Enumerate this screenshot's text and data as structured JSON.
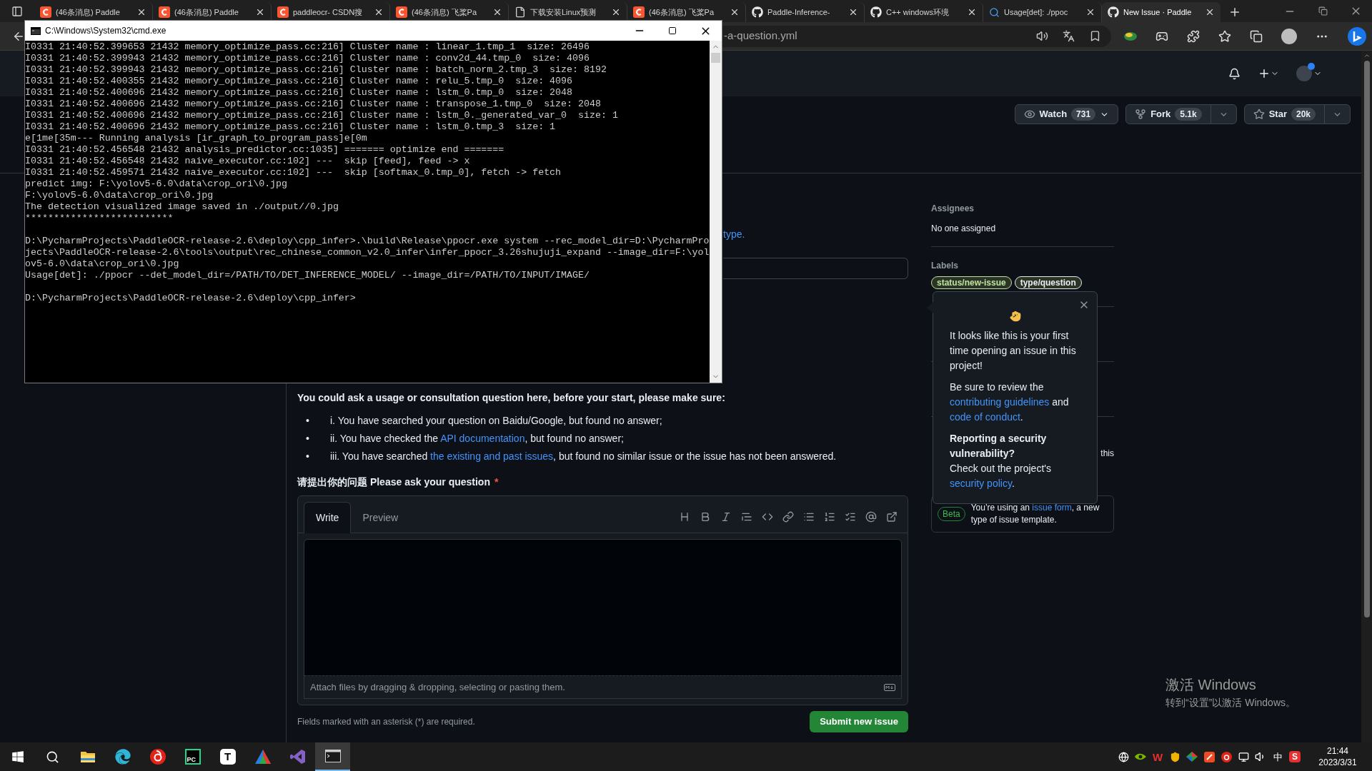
{
  "browser": {
    "tabs": [
      {
        "kind": "csdn",
        "title": "(46条消息) Paddle",
        "selected": false
      },
      {
        "kind": "csdn",
        "title": "(46条消息) Paddle",
        "selected": false
      },
      {
        "kind": "csdn",
        "title": "paddleocr- CSDN搜",
        "selected": false
      },
      {
        "kind": "csdn",
        "title": "(46条消息) 飞桨Pa",
        "selected": false
      },
      {
        "kind": "page",
        "title": "下载安装Linux预测",
        "selected": false
      },
      {
        "kind": "csdn",
        "title": "(46条消息) 飞桨Pa",
        "selected": false
      },
      {
        "kind": "github",
        "title": "Paddle-Inference-",
        "selected": false
      },
      {
        "kind": "github",
        "title": "C++ windows环境",
        "selected": false
      },
      {
        "kind": "search",
        "title": "Usage[det]: ./ppoc",
        "selected": false
      },
      {
        "kind": "github",
        "title": "New Issue · Paddle",
        "selected": true
      }
    ],
    "address": {
      "url": "-a-question.yml"
    }
  },
  "console": {
    "title": "C:\\Windows\\System32\\cmd.exe",
    "blocks": [
      [
        "I0331 21:40:52.399653 21432 memory_optimize_pass.cc:216] Cluster name : linear_1.tmp_1  size: 26496",
        "I0331 21:40:52.399943 21432 memory_optimize_pass.cc:216] Cluster name : conv2d_44.tmp_0  size: 4096",
        "I0331 21:40:52.399943 21432 memory_optimize_pass.cc:216] Cluster name : batch_norm_2.tmp_3  size: 8192",
        "I0331 21:40:52.400355 21432 memory_optimize_pass.cc:216] Cluster name : relu_5.tmp_0  size: 4096",
        "I0331 21:40:52.400696 21432 memory_optimize_pass.cc:216] Cluster name : lstm_0.tmp_0  size: 2048",
        "I0331 21:40:52.400696 21432 memory_optimize_pass.cc:216] Cluster name : transpose_1.tmp_0  size: 2048",
        "I0331 21:40:52.400696 21432 memory_optimize_pass.cc:216] Cluster name : lstm_0._generated_var_0  size: 1",
        "I0331 21:40:52.400696 21432 memory_optimize_pass.cc:216] Cluster name : lstm_0.tmp_3  size: 1",
        "e[1me[35m--- Running analysis [ir_graph_to_program_pass]e[0m",
        "I0331 21:40:52.456548 21432 analysis_predictor.cc:1035] ======= optimize end =======",
        "I0331 21:40:52.456548 21432 naive_executor.cc:102] ---  skip [feed], feed -> x",
        "I0331 21:40:52.459571 21432 naive_executor.cc:102] ---  skip [softmax_0.tmp_0], fetch -> fetch",
        "predict img: F:\\yolov5-6.0\\data\\crop_ori\\0.jpg",
        "F:\\yolov5-6.0\\data\\crop_ori\\0.jpg",
        "The detection visualized image saved in ./output//0.jpg",
        "**************************"
      ],
      [
        "D:\\PycharmProjects\\PaddleOCR-release-2.6\\deploy\\cpp_infer>.\\build\\Release\\ppocr.exe system --rec_model_dir=D:\\PycharmPro",
        "jects\\PaddleOCR-release-2.6\\tools\\output\\rec_chinese_common_v2.0_infer\\infer_ppocr_3.26shujuji_expand --image_dir=F:\\yol",
        "ov5-6.0\\data\\crop_ori\\0.jpg",
        "Usage[det]: ./ppocr --det_model_dir=/PATH/TO/DET_INFERENCE_MODEL/ --image_dir=/PATH/TO/INPUT/IMAGE/"
      ],
      [
        "D:\\PycharmProjects\\PaddleOCR-release-2.6\\deploy\\cpp_infer>"
      ]
    ]
  },
  "repo_actions": [
    {
      "kind": "watch",
      "label": "Watch",
      "count": "731"
    },
    {
      "kind": "fork",
      "label": "Fork",
      "count": "5.1k"
    },
    {
      "kind": "star",
      "label": "Star",
      "count": "20k"
    }
  ],
  "form": {
    "hint_tail": "type.",
    "intro": "You could ask a usage or consultation question here, before your start, please make sure:",
    "checklist": [
      {
        "marker": "•",
        "segments": [
          {
            "kind": "text",
            "text": "i. You have searched your question on Baidu/Google, but found no answer;"
          }
        ]
      },
      {
        "marker": "•",
        "segments": [
          {
            "kind": "text",
            "text": "ii. You have checked the "
          },
          {
            "kind": "link",
            "text": "API documentation"
          },
          {
            "kind": "text",
            "text": ", but found no answer;"
          }
        ]
      },
      {
        "marker": "•",
        "segments": [
          {
            "kind": "text",
            "text": "iii. You have searched "
          },
          {
            "kind": "link",
            "text": "the existing and past issues"
          },
          {
            "kind": "text",
            "text": ", but found no similar issue or the issue has not been answered."
          }
        ]
      }
    ],
    "question_label": "请提出你的问题 Please ask your question",
    "required_mark": "*",
    "editor": {
      "tabs": [
        {
          "label": "Write",
          "selected": true
        },
        {
          "label": "Preview",
          "selected": false
        }
      ],
      "attach_hint": "Attach files by dragging & dropping, selecting or pasting them."
    },
    "required_note": "Fields marked with an asterisk (*) are required.",
    "submit": "Submit new issue"
  },
  "sidebar": {
    "assignees_heading": "Assignees",
    "assignees_value": "No one assigned",
    "labels_heading": "Labels",
    "labels": [
      {
        "name": "status/new-issue",
        "color": "#bfe3a0"
      },
      {
        "name": "type/question",
        "color": "#e6edf3"
      }
    ],
    "hidden_tail": "this",
    "beta": {
      "badge": "Beta",
      "segments": [
        {
          "kind": "text",
          "text": "You’re using an "
        },
        {
          "kind": "link",
          "text": "issue form"
        },
        {
          "kind": "text",
          "text": ", a new type of issue template."
        }
      ]
    }
  },
  "popover": {
    "paragraphs": [
      {
        "segments": [
          {
            "kind": "text",
            "text": "It looks like this is your first time opening an issue in this project!"
          }
        ]
      },
      {
        "segments": [
          {
            "kind": "text",
            "text": "Be sure to review the "
          },
          {
            "kind": "link",
            "text": "contributing guidelines"
          },
          {
            "kind": "text",
            "text": " and "
          },
          {
            "kind": "link",
            "text": "code of conduct"
          },
          {
            "kind": "text",
            "text": "."
          }
        ]
      },
      {
        "title": "Reporting a security vulnerability?",
        "segments": [
          {
            "kind": "text",
            "text": "Check out the project's "
          },
          {
            "kind": "link",
            "text": "security policy"
          },
          {
            "kind": "text",
            "text": "."
          }
        ]
      }
    ]
  },
  "activation": {
    "title": "激活 Windows",
    "subtitle": "转到“设置”以激活 Windows。"
  },
  "taskbar": {
    "items": [
      {
        "kind": "windows",
        "selected": false
      },
      {
        "kind": "search",
        "selected": false
      },
      {
        "kind": "folder",
        "selected": false
      },
      {
        "kind": "edge",
        "selected": false
      },
      {
        "kind": "music",
        "selected": false
      },
      {
        "kind": "letter",
        "glyph": "PC",
        "selected": false
      },
      {
        "kind": "tile",
        "glyph": "T",
        "selected": false
      },
      {
        "kind": "triangle",
        "selected": false
      },
      {
        "kind": "vs",
        "selected": false
      },
      {
        "kind": "terminal",
        "selected": true
      }
    ],
    "tray": [
      {
        "kind": "globe"
      },
      {
        "kind": "nvidia"
      },
      {
        "kind": "glyph",
        "glyph": "W"
      },
      {
        "kind": "shield"
      },
      {
        "kind": "colorful"
      },
      {
        "kind": "square"
      },
      {
        "kind": "music"
      },
      {
        "kind": "monitor"
      },
      {
        "kind": "volume"
      },
      {
        "kind": "text",
        "glyph": "中"
      },
      {
        "kind": "badge",
        "glyph": "S"
      }
    ],
    "time": "21:44",
    "date": "2023/3/31"
  }
}
